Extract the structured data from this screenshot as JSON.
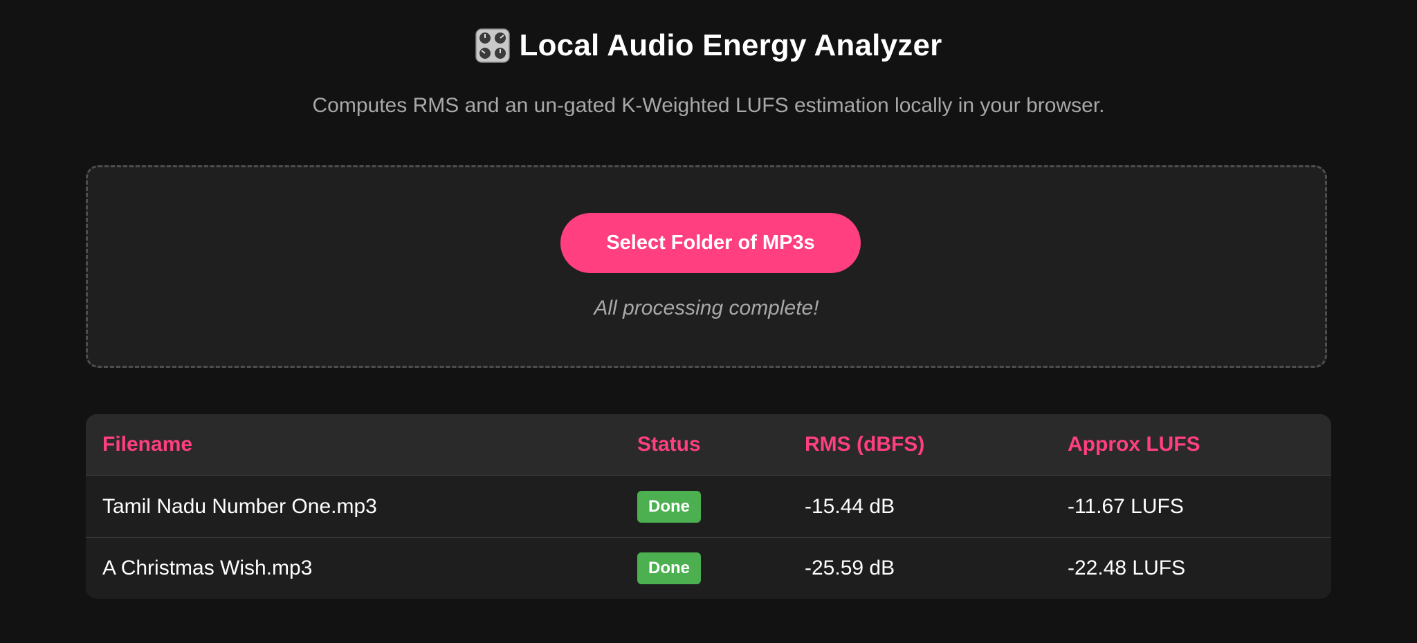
{
  "header": {
    "title": "Local Audio Energy Analyzer",
    "title_icon": "control-knobs-icon",
    "subtitle": "Computes RMS and an un-gated K-Weighted LUFS estimation locally in your browser."
  },
  "upload": {
    "button_label": "Select Folder of MP3s",
    "status_message": "All processing complete!"
  },
  "table": {
    "columns": [
      "Filename",
      "Status",
      "RMS (dBFS)",
      "Approx LUFS"
    ],
    "rows": [
      {
        "filename": "Tamil Nadu Number One.mp3",
        "status": "Done",
        "rms": "-15.44 dB",
        "lufs": "-11.67 LUFS"
      },
      {
        "filename": "A Christmas Wish.mp3",
        "status": "Done",
        "rms": "-25.59 dB",
        "lufs": "-22.48 LUFS"
      }
    ]
  },
  "colors": {
    "accent": "#ff3f7f",
    "success": "#4caf50",
    "background": "#121212",
    "panel": "#1f1f1f"
  }
}
